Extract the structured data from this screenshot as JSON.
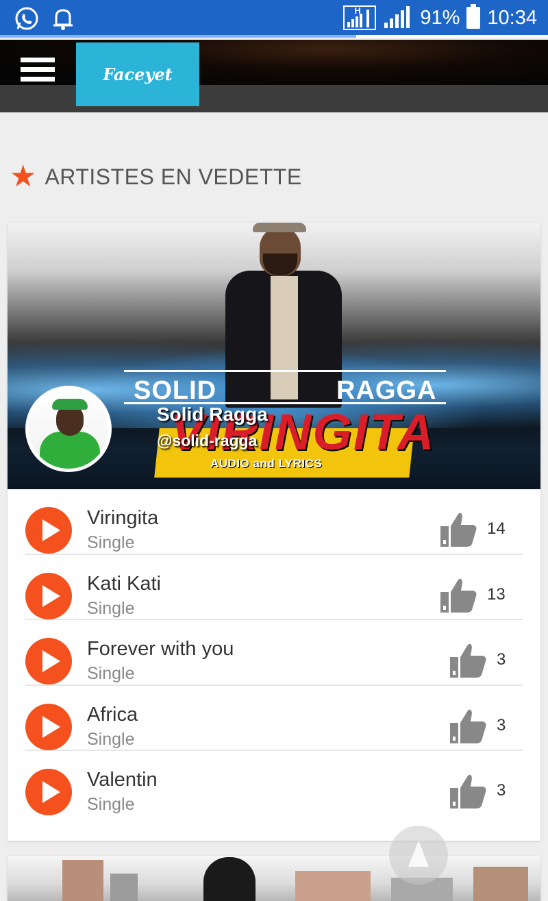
{
  "status_bar": {
    "battery": "91%",
    "time": "10:34",
    "network_small_label": "H"
  },
  "header": {
    "logo_text": "Faceyet"
  },
  "section": {
    "title": "ARTISTES EN VEDETTE"
  },
  "featured": {
    "artist_name": "Solid Ragga",
    "artist_handle": "@solid-ragga",
    "banner_word_left": "SOLID",
    "banner_word_right": "RAGGA",
    "banner_song": "VIRINGITA",
    "banner_tagline": "AUDIO and LYRICS",
    "tracks": [
      {
        "title": "Viringita",
        "type": "Single",
        "likes": "14"
      },
      {
        "title": "Kati Kati",
        "type": "Single",
        "likes": "13"
      },
      {
        "title": "Forever with you",
        "type": "Single",
        "likes": "3"
      },
      {
        "title": "Africa",
        "type": "Single",
        "likes": "3"
      },
      {
        "title": "Valentin",
        "type": "Single",
        "likes": "3"
      }
    ]
  },
  "colors": {
    "status_bar": "#1d66c7",
    "accent": "#f4511e",
    "logo_bg": "#2bb3d8"
  },
  "icons": [
    "whatsapp-icon",
    "notification-bell-icon",
    "signal-icon",
    "battery-icon",
    "hamburger-menu-icon",
    "star-icon",
    "play-icon",
    "thumbs-up-icon",
    "scroll-top-arrow-icon"
  ]
}
